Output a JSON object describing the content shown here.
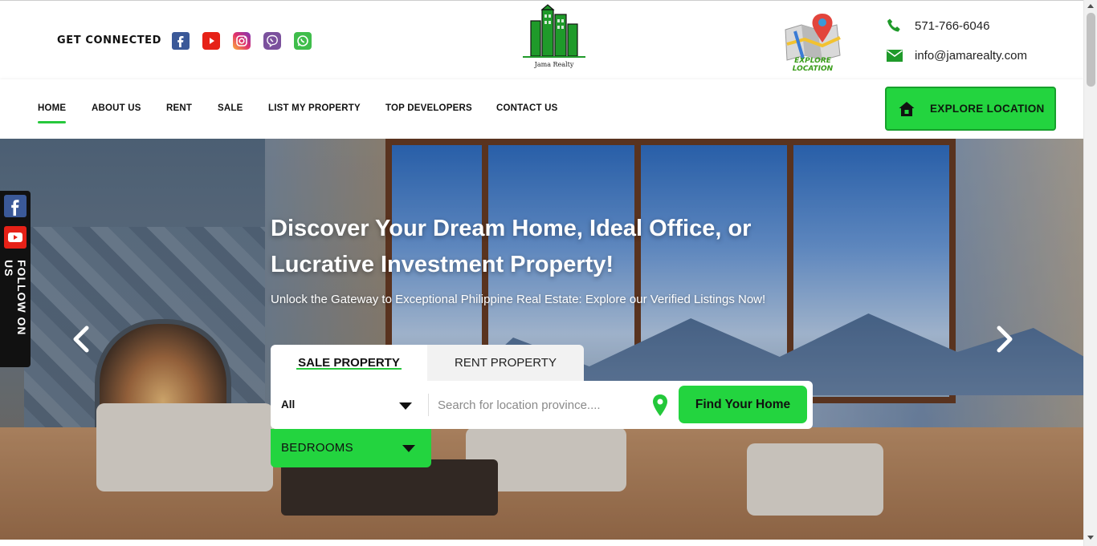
{
  "header": {
    "get_connected": "GET CONNECTED",
    "social_icons": [
      "facebook-icon",
      "youtube-icon",
      "instagram-icon",
      "viber-icon",
      "whatsapp-icon"
    ],
    "logo_text": "Jama Realty",
    "explore_graphic_text": "EXPLORE LOCATION",
    "phone": "571-766-6046",
    "email": "info@jamarealty.com"
  },
  "nav": {
    "items": [
      "HOME",
      "ABOUT US",
      "RENT",
      "SALE",
      "LIST MY PROPERTY",
      "TOP DEVELOPERS",
      "CONTACT US"
    ],
    "active": "HOME",
    "explore_button": "EXPLORE LOCATION"
  },
  "hero": {
    "title": "Discover Your Dream Home, Ideal Office, or Lucrative Investment Property!",
    "subtitle": "Unlock the Gateway to Exceptional Philippine Real Estate: Explore our Verified Listings Now!",
    "tabs": [
      "SALE PROPERTY",
      "RENT PROPERTY"
    ],
    "active_tab": "SALE PROPERTY",
    "type_select_value": "All",
    "search_placeholder": "Search for location province....",
    "find_button": "Find Your Home",
    "bedrooms_label": "BEDROOMS"
  },
  "sidebar": {
    "follow_text": "FOLLOW ON US"
  },
  "colors": {
    "accent_green": "#23d43f",
    "facebook": "#3b5998",
    "youtube": "#e62117"
  }
}
